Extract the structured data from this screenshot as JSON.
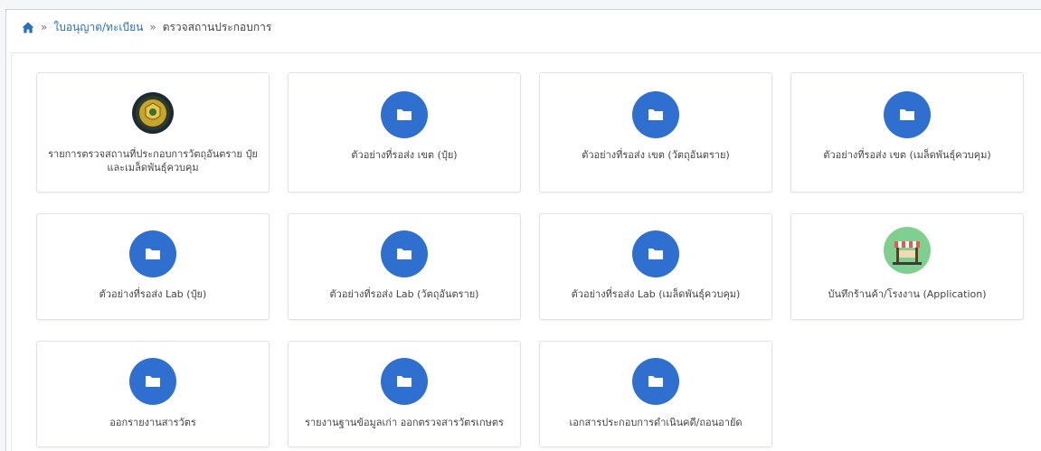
{
  "breadcrumb": {
    "home_icon": "home-icon",
    "separator": "»",
    "items": [
      "ใบอนุญาต/ทะเบียน",
      "ตรวจสถานประกอบการ"
    ]
  },
  "colors": {
    "accent": "#2b6fc2",
    "folder_circle": "#2f6fcf"
  },
  "cards": [
    {
      "label": "รายการตรวจสถานที่ประกอบการวัตถุอันตราย ปุ๋ย และเมล็ดพันธุ์ควบคุม",
      "icon": "department-seal-icon"
    },
    {
      "label": "ตัวอย่างที่รอส่ง เขต (ปุ๋ย)",
      "icon": "folder-icon"
    },
    {
      "label": "ตัวอย่างที่รอส่ง เขต (วัตถุอันตราย)",
      "icon": "folder-icon"
    },
    {
      "label": "ตัวอย่างที่รอส่ง เขต (เมล็ดพันธุ์ควบคุม)",
      "icon": "folder-icon"
    },
    {
      "label": "ตัวอย่างที่รอส่ง Lab (ปุ๋ย)",
      "icon": "folder-icon"
    },
    {
      "label": "ตัวอย่างที่รอส่ง Lab (วัตถุอันตราย)",
      "icon": "folder-icon"
    },
    {
      "label": "ตัวอย่างที่รอส่ง Lab (เมล็ดพันธุ์ควบคุม)",
      "icon": "folder-icon"
    },
    {
      "label": "บันทึกร้านค้า/โรงงาน (Application)",
      "icon": "shop-icon"
    },
    {
      "label": "ออกรายงานสารวัตร",
      "icon": "folder-icon"
    },
    {
      "label": "รายงานฐานข้อมูลเก่า ออกตรวจสารวัตรเกษตร",
      "icon": "folder-icon"
    },
    {
      "label": "เอกสารประกอบการดำเนินคดี/ถอนอายัด",
      "icon": "folder-icon"
    }
  ]
}
